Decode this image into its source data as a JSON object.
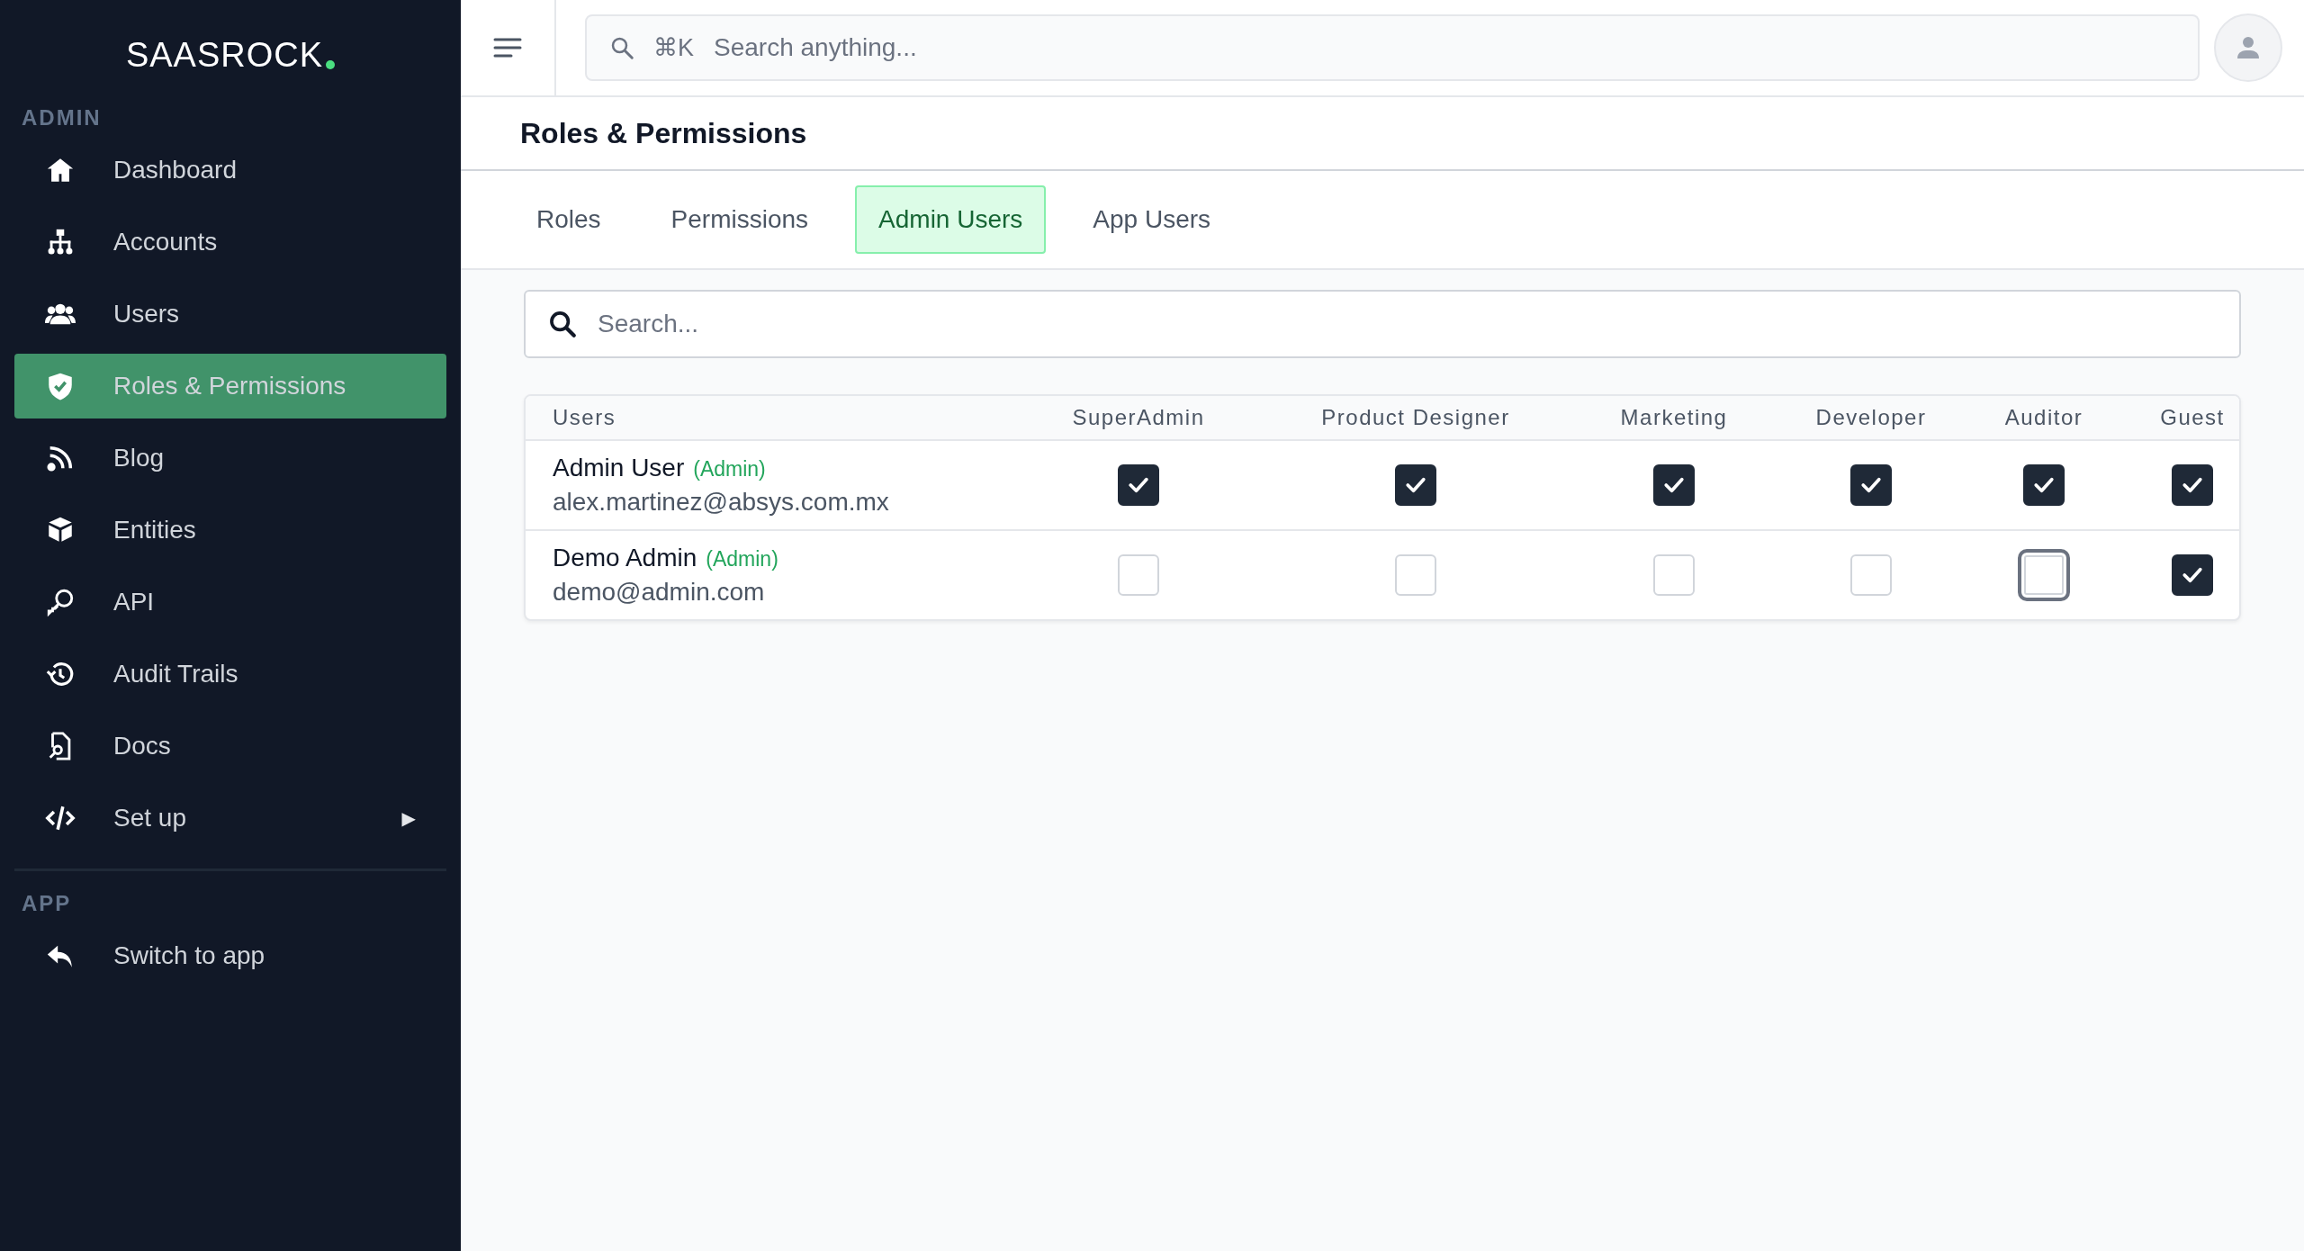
{
  "sidebar": {
    "logo": "**SAAS**ROCK",
    "sections": [
      {
        "title": "ADMIN",
        "items": [
          {
            "label": "Dashboard",
            "selected": false
          },
          {
            "label": "Accounts",
            "selected": false
          },
          {
            "label": "Users",
            "selected": false
          },
          {
            "label": "Roles & Permissions",
            "selected": true
          },
          {
            "label": "Blog",
            "selected": false
          },
          {
            "label": "Entities",
            "selected": false
          },
          {
            "label": "API",
            "selected": false
          },
          {
            "label": "Audit Trails",
            "selected": false
          },
          {
            "label": "Docs",
            "selected": false
          },
          {
            "label": "Set up",
            "selected": false,
            "expander": "▶"
          }
        ]
      },
      {
        "title": "APP",
        "items": [
          {
            "label": "Switch to app",
            "selected": false
          }
        ]
      }
    ]
  },
  "topbar": {
    "shortcut": "⌘K",
    "placeholder": "Search anything..."
  },
  "page": {
    "title": "Roles & Permissions"
  },
  "tabs": [
    {
      "label": "Roles",
      "selected": false
    },
    {
      "label": "Permissions",
      "selected": false
    },
    {
      "label": "Admin Users",
      "selected": true
    },
    {
      "label": "App Users",
      "selected": false
    }
  ],
  "search": {
    "placeholder": "Search..."
  },
  "table": {
    "columns": [
      "Users",
      "SuperAdmin",
      "Product Designer",
      "Marketing",
      "Developer",
      "Auditor",
      "Guest"
    ],
    "rows": [
      {
        "name": "Admin User",
        "badge": "(Admin)",
        "email": "alex.martinez@absys.com.mx",
        "roles": [
          {
            "checked": true,
            "focused": false
          },
          {
            "checked": true,
            "focused": false
          },
          {
            "checked": true,
            "focused": false
          },
          {
            "checked": true,
            "focused": false
          },
          {
            "checked": true,
            "focused": false
          },
          {
            "checked": true,
            "focused": false
          }
        ]
      },
      {
        "name": "Demo Admin",
        "badge": "(Admin)",
        "email": "demo@admin.com",
        "roles": [
          {
            "checked": false,
            "focused": false
          },
          {
            "checked": false,
            "focused": false
          },
          {
            "checked": false,
            "focused": false
          },
          {
            "checked": false,
            "focused": false
          },
          {
            "checked": false,
            "focused": true
          },
          {
            "checked": true,
            "focused": false
          }
        ]
      }
    ]
  }
}
